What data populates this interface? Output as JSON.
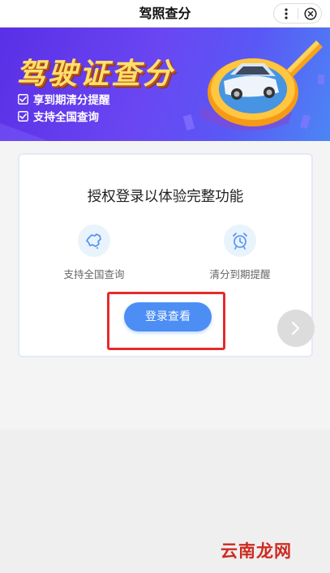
{
  "header": {
    "title": "驾照查分",
    "more_icon": "more-dots-icon",
    "close_icon": "close-circle-icon"
  },
  "banner": {
    "title": "驾驶证查分",
    "features": [
      "享到期清分提醒",
      "支持全国查询"
    ],
    "colors": {
      "title": "#ffe06a",
      "bg_start": "#5a2fe6",
      "bg_end": "#4c86f5"
    }
  },
  "card": {
    "title": "授权登录以体验完整功能",
    "features": [
      {
        "icon": "china-map-icon",
        "label": "支持全国查询"
      },
      {
        "icon": "alarm-clock-icon",
        "label": "清分到期提醒"
      }
    ],
    "login_button": "登录查看",
    "accent": "#4d8ef5",
    "highlight_color": "#e62b2b"
  },
  "watermark": "云南龙网"
}
